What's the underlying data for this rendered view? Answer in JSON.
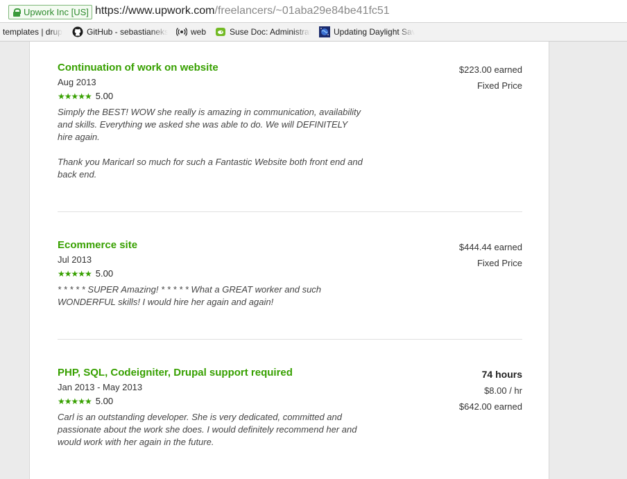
{
  "address_bar": {
    "ev_label": "Upwork Inc [US]",
    "url_scheme_host": "https://www.upwork.com",
    "url_path": "/freelancers/~01aba29e84be41fc51"
  },
  "bookmarks": [
    {
      "label": "templates | drup",
      "icon": "page-icon"
    },
    {
      "label": "GitHub - sebastianeks",
      "icon": "github-icon"
    },
    {
      "label": "web",
      "icon": "radio-wave-icon"
    },
    {
      "label": "Suse Doc: Administrat",
      "icon": "suse-icon"
    },
    {
      "label": "Updating Daylight Sav",
      "icon": "globe-icon"
    }
  ],
  "accent_color": "#37a000",
  "jobs": [
    {
      "title": "Continuation of work on website",
      "date": "Aug 2013",
      "stars": "★★★★★",
      "score": "5.00",
      "comment": "Simply the BEST! WOW she really is amazing in communication, availability and skills. Everything we asked she was able to do. We will DEFINITELY hire again.\n\nThank you Maricarl so much for such a Fantastic Website both front end and back end.",
      "earned": "$223.00 earned",
      "contract": "Fixed Price"
    },
    {
      "title": "Ecommerce site",
      "date": "Jul 2013",
      "stars": "★★★★★",
      "score": "5.00",
      "comment": "* * * * * SUPER Amazing! * * * * * What a GREAT worker and such WONDERFUL skills! I would hire her again and again!",
      "earned": "$444.44 earned",
      "contract": "Fixed Price"
    },
    {
      "title": "PHP, SQL, Codeigniter, Drupal support required",
      "date": "Jan 2013 - May 2013",
      "stars": "★★★★★",
      "score": "5.00",
      "comment": "Carl is an outstanding developer. She is very dedicated, committed and passionate about the work she does. I would definitely recommend her and would work with her again in the future.",
      "hours": "74 hours",
      "rate": "$8.00 / hr",
      "earned": "$642.00 earned"
    }
  ]
}
